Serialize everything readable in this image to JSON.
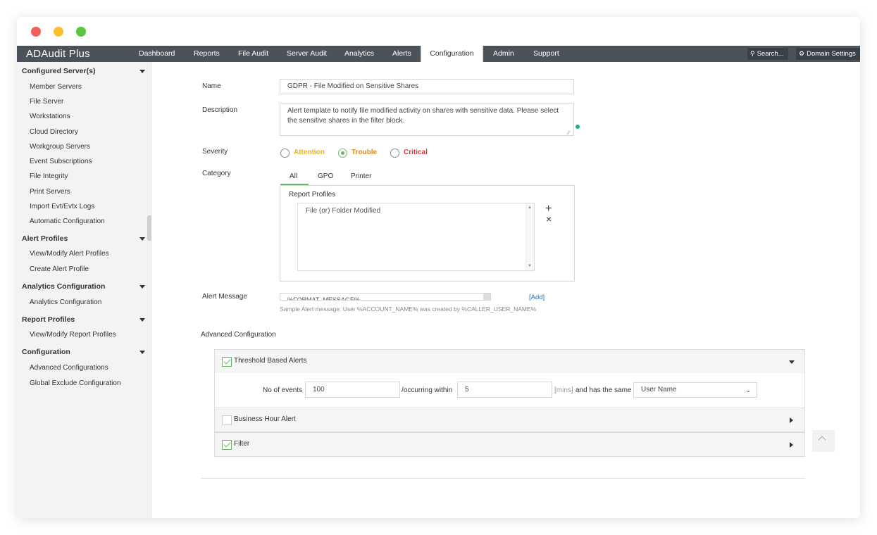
{
  "app": {
    "title": "ADAudit Plus"
  },
  "nav": {
    "tabs": [
      "Dashboard",
      "Reports",
      "File Audit",
      "Server Audit",
      "Analytics",
      "Alerts",
      "Configuration",
      "Admin",
      "Support"
    ],
    "active": "Configuration",
    "search_label": "Search...",
    "domain_settings_label": "Domain Settings"
  },
  "sidebar": {
    "sections": [
      {
        "title": "Configured Server(s)",
        "items": [
          "Member Servers",
          "File Server",
          "Workstations",
          "Cloud Directory",
          "Workgroup Servers",
          "Event Subscriptions",
          "File Integrity",
          "Print Servers",
          "Import Evt/Evtx Logs",
          "Automatic Configuration"
        ]
      },
      {
        "title": "Alert Profiles",
        "items": [
          "View/Modify Alert Profiles",
          "Create Alert Profile"
        ]
      },
      {
        "title": "Analytics Configuration",
        "items": [
          "Analytics Configuration"
        ]
      },
      {
        "title": "Report Profiles",
        "items": [
          "View/Modify Report Profiles"
        ]
      },
      {
        "title": "Configuration",
        "items": [
          "Advanced Configurations",
          "Global Exclude Configuration"
        ]
      }
    ]
  },
  "form": {
    "name_label": "Name",
    "name_value": "GDPR - File Modified on Sensitive Shares",
    "description_label": "Description",
    "description_value": "Alert template to notify file modified activity on shares with sensitive data. Please select the sensitive shares in the filter block.",
    "severity_label": "Severity",
    "severity_options": [
      {
        "label": "Attention",
        "color": "#e6b422",
        "selected": false
      },
      {
        "label": "Trouble",
        "color": "#e8891e",
        "selected": true
      },
      {
        "label": "Critical",
        "color": "#d9383c",
        "selected": false
      }
    ],
    "category_label": "Category",
    "category_tabs": [
      "All",
      "GPO",
      "Printer"
    ],
    "category_active": "All",
    "report_profiles_label": "Report Profiles",
    "report_profiles_items": [
      "File (or) Folder Modified"
    ],
    "add_icon": "+",
    "remove_icon": "×",
    "alert_message_label": "Alert Message",
    "alert_message_value": "%FORMAT_MESSAGE%",
    "add_link": "[Add]",
    "sample_message": "Sample Alert message: User %ACCOUNT_NAME% was created by %CALLER_USER_NAME%"
  },
  "advanced": {
    "title": "Advanced Configuration",
    "threshold": {
      "label": "Threshold Based Alerts",
      "checked": true,
      "events_label": "No of events",
      "events_value": "100",
      "within_label": "/occurring within",
      "within_value": "5",
      "mins_label": "[mins]",
      "same_label": "and has the same",
      "same_value": "User Name"
    },
    "business_hour": {
      "label": "Business Hour Alert",
      "checked": false
    },
    "filter": {
      "label": "Filter",
      "checked": true
    }
  },
  "colors": {
    "nav_bg": "#4b525a",
    "accent_green": "#6bb86b",
    "link_blue": "#2a6db5"
  }
}
